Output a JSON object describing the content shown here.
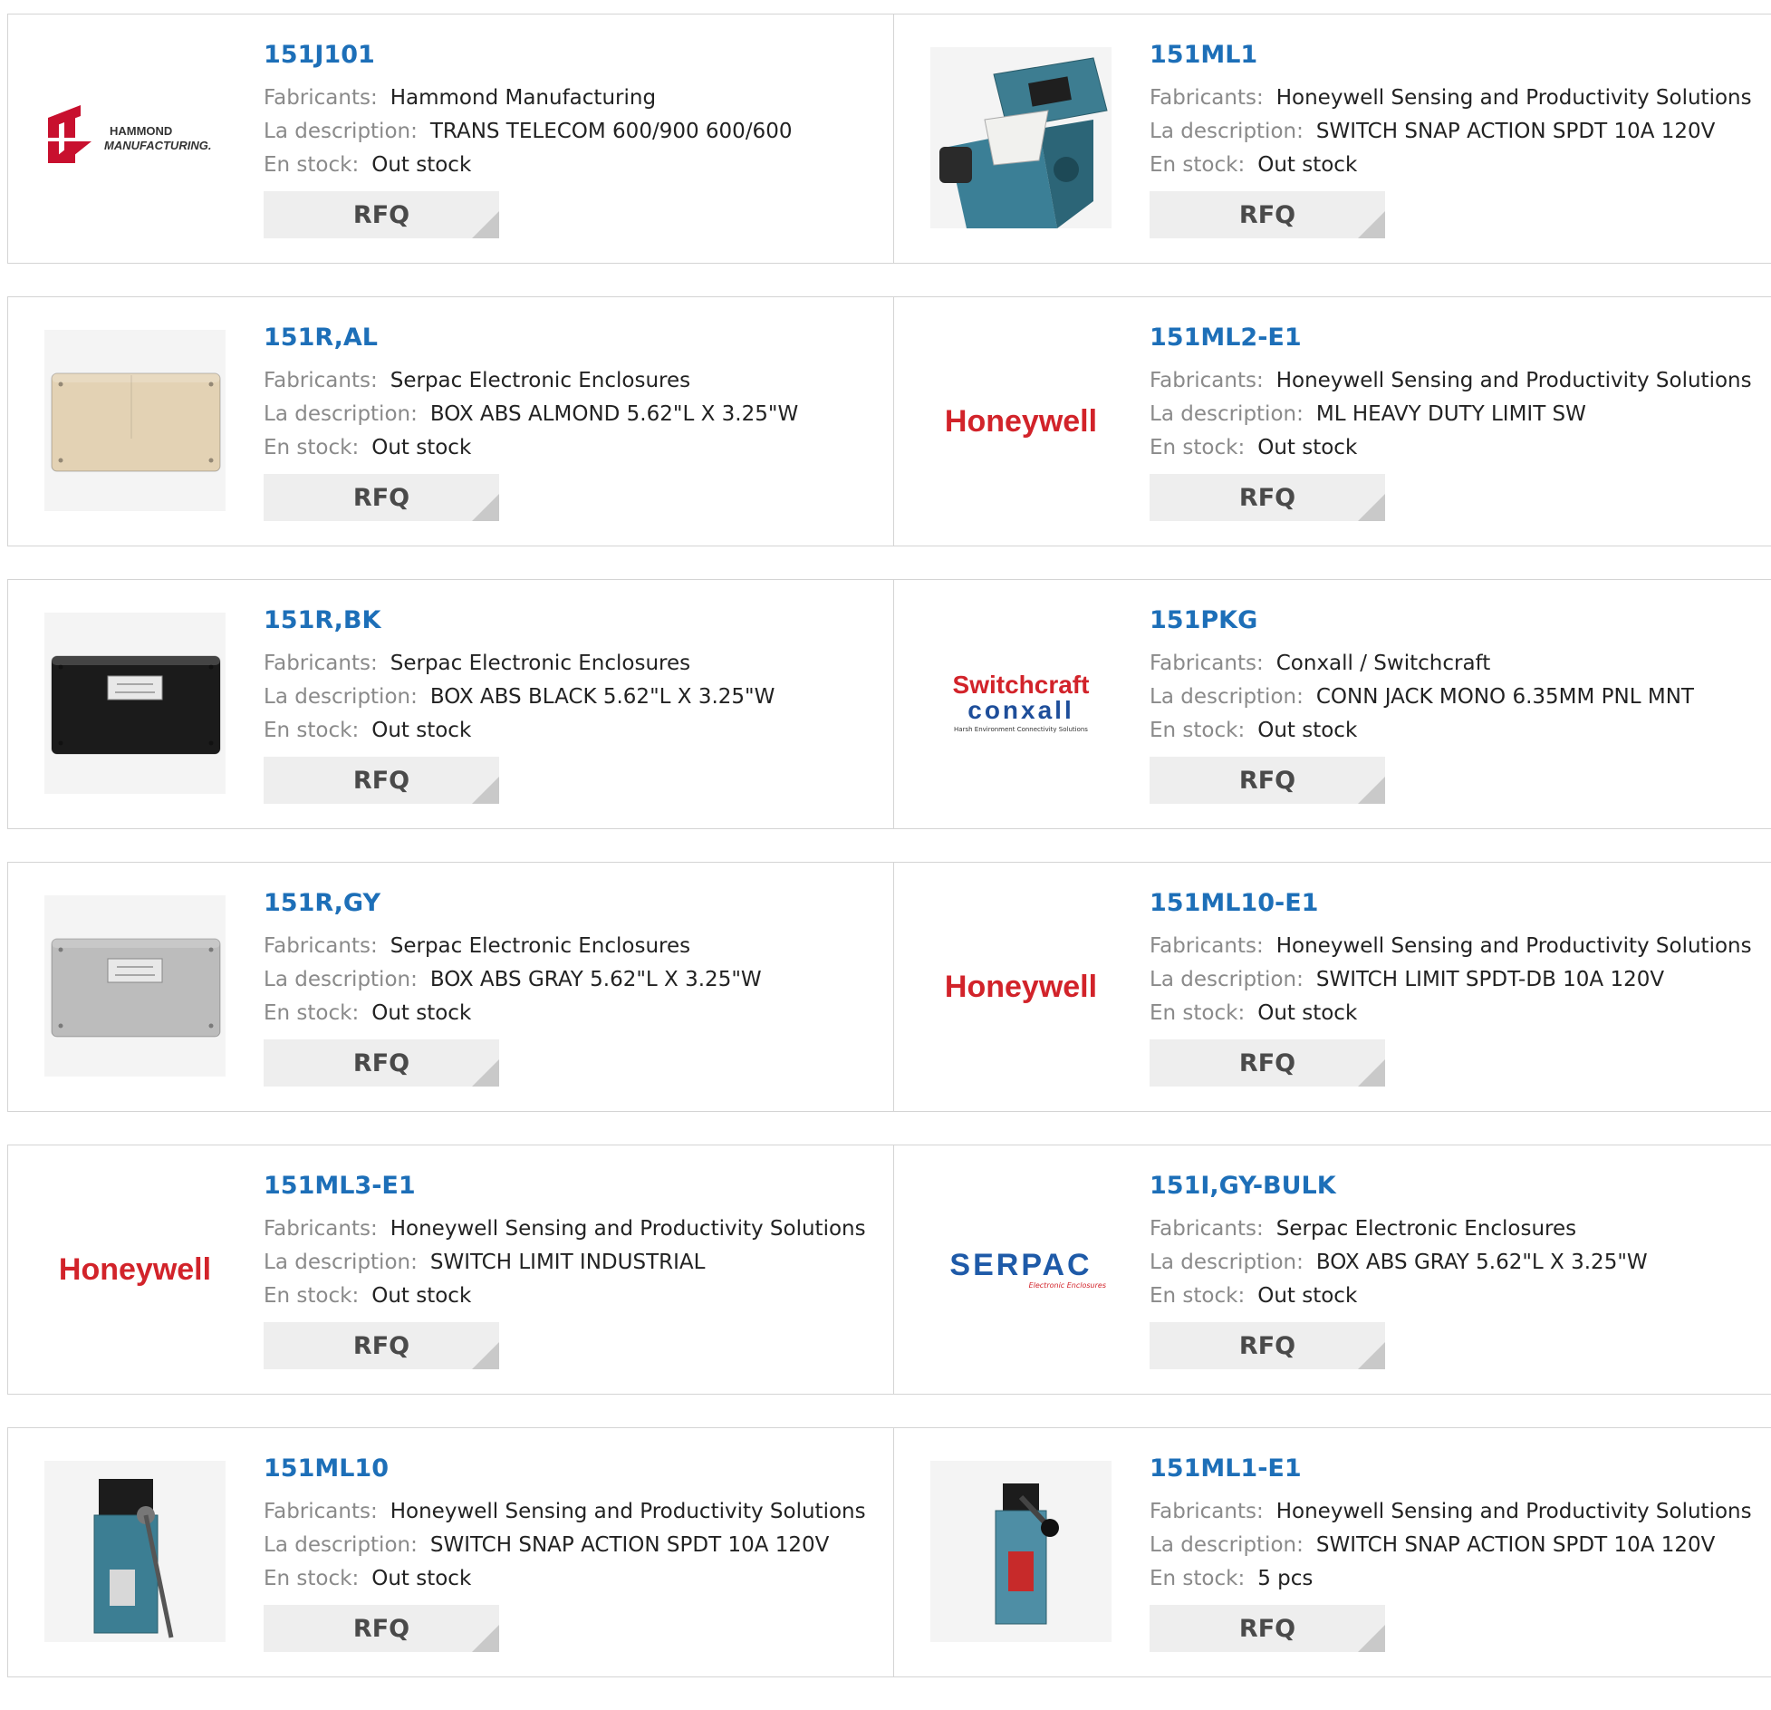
{
  "labels": {
    "manufacturer": "Fabricants:",
    "description": "La description:",
    "stock": "En stock:",
    "rfq": "RFQ"
  },
  "products": [
    {
      "part": "151J101",
      "manufacturer": "Hammond Manufacturing",
      "description": "TRANS TELECOM 600/900 600/600",
      "stock": "Out stock",
      "image": "hammond-logo",
      "logo_text_1": "HAMMOND",
      "logo_text_2": "MANUFACTURING."
    },
    {
      "part": "151ML1",
      "manufacturer": "Honeywell Sensing and Productivity Solutions",
      "description": "SWITCH SNAP ACTION SPDT 10A 120V",
      "stock": "Out stock",
      "image": "limit-switch-photo"
    },
    {
      "part": "151R,AL",
      "manufacturer": "Serpac Electronic Enclosures",
      "description": "BOX ABS ALMOND 5.62\"L X 3.25\"W",
      "stock": "Out stock",
      "image": "almond-box-photo",
      "box_color": "#e3d2b4"
    },
    {
      "part": "151ML2-E1",
      "manufacturer": "Honeywell Sensing and Productivity Solutions",
      "description": "ML HEAVY DUTY LIMIT SW",
      "stock": "Out stock",
      "image": "honeywell-logo",
      "logo_text": "Honeywell"
    },
    {
      "part": "151R,BK",
      "manufacturer": "Serpac Electronic Enclosures",
      "description": "BOX ABS BLACK 5.62\"L X 3.25\"W",
      "stock": "Out stock",
      "image": "black-box-photo",
      "box_color": "#1b1b1b"
    },
    {
      "part": "151PKG",
      "manufacturer": "Conxall / Switchcraft",
      "description": "CONN JACK MONO 6.35MM PNL MNT",
      "stock": "Out stock",
      "image": "switchcraft-logo",
      "logo_text_1": "Switchcraft",
      "logo_text_2": "conxall",
      "logo_text_3": "Harsh Environment Connectivity Solutions"
    },
    {
      "part": "151R,GY",
      "manufacturer": "Serpac Electronic Enclosures",
      "description": "BOX ABS GRAY 5.62\"L X 3.25\"W",
      "stock": "Out stock",
      "image": "gray-box-photo",
      "box_color": "#bcbcbc"
    },
    {
      "part": "151ML10-E1",
      "manufacturer": "Honeywell Sensing and Productivity Solutions",
      "description": "SWITCH LIMIT SPDT-DB 10A 120V",
      "stock": "Out stock",
      "image": "honeywell-logo",
      "logo_text": "Honeywell"
    },
    {
      "part": "151ML3-E1",
      "manufacturer": "Honeywell Sensing and Productivity Solutions",
      "description": "SWITCH LIMIT INDUSTRIAL",
      "stock": "Out stock",
      "image": "honeywell-logo",
      "logo_text": "Honeywell"
    },
    {
      "part": "151I,GY-BULK",
      "manufacturer": "Serpac Electronic Enclosures",
      "description": "BOX ABS GRAY 5.62\"L X 3.25\"W",
      "stock": "Out stock",
      "image": "serpac-logo",
      "logo_text_1": "SERPAC",
      "logo_text_2": "Electronic Enclosures"
    },
    {
      "part": "151ML10",
      "manufacturer": "Honeywell Sensing and Productivity Solutions",
      "description": "SWITCH SNAP ACTION SPDT 10A 120V",
      "stock": "Out stock",
      "image": "limit-switch-lever-photo"
    },
    {
      "part": "151ML1-E1",
      "manufacturer": "Honeywell Sensing and Productivity Solutions",
      "description": "SWITCH SNAP ACTION SPDT 10A 120V",
      "stock": "5 pcs",
      "image": "limit-switch-roller-photo"
    }
  ],
  "colors": {
    "part_link": "#1d6fb8",
    "honeywell_red": "#d2232a",
    "serpac_blue": "#1e5aa8",
    "switchcraft_red": "#d2232a",
    "conxall_blue": "#1e4e9a"
  }
}
